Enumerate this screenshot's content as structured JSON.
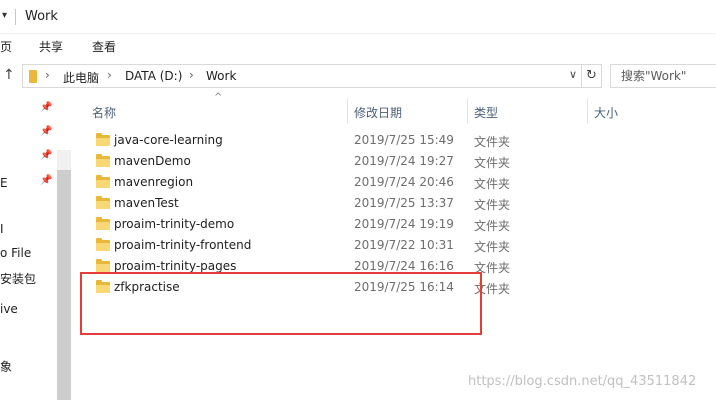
{
  "window": {
    "title": "Work"
  },
  "ribbon": {
    "tabs": [
      "页",
      "共享",
      "查看"
    ]
  },
  "address": {
    "crumbs": [
      "此电脑",
      "DATA (D:)",
      "Work"
    ],
    "search_placeholder": "搜索\"Work\""
  },
  "nav": {
    "items": [
      "E",
      "I",
      "o File",
      "安装包",
      "ive",
      "象"
    ]
  },
  "columns": {
    "name": "名称",
    "date": "修改日期",
    "type": "类型",
    "size": "大小"
  },
  "files": [
    {
      "name": "java-core-learning",
      "date": "2019/7/25 15:49",
      "type": "文件夹"
    },
    {
      "name": "mavenDemo",
      "date": "2019/7/24 19:27",
      "type": "文件夹"
    },
    {
      "name": "mavenregion",
      "date": "2019/7/24 20:46",
      "type": "文件夹"
    },
    {
      "name": "mavenTest",
      "date": "2019/7/25 13:37",
      "type": "文件夹"
    },
    {
      "name": "proaim-trinity-demo",
      "date": "2019/7/24 19:19",
      "type": "文件夹"
    },
    {
      "name": "proaim-trinity-frontend",
      "date": "2019/7/22 10:31",
      "type": "文件夹"
    },
    {
      "name": "proaim-trinity-pages",
      "date": "2019/7/24 16:16",
      "type": "文件夹"
    },
    {
      "name": "zfkpractise",
      "date": "2019/7/25 16:14",
      "type": "文件夹"
    }
  ],
  "watermark": "https://blog.csdn.net/qq_43511842",
  "colors": {
    "highlight": "#e63c3c",
    "folder": "#e8b83a",
    "header_text": "#4c607a"
  }
}
